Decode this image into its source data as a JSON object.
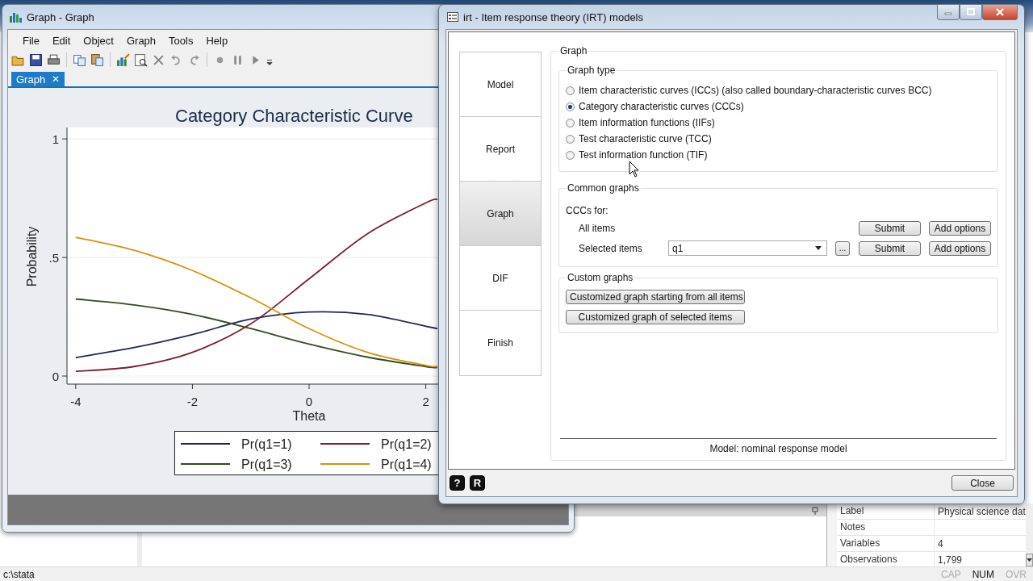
{
  "graph_window": {
    "title": "Graph - Graph",
    "menu": [
      "File",
      "Edit",
      "Object",
      "Graph",
      "Tools",
      "Help"
    ],
    "tabs": [
      {
        "label": "Graph",
        "close": "✕",
        "selected": true
      }
    ],
    "chart_data": {
      "type": "line",
      "title": "Category Characteristic Curve",
      "xlabel": "Theta",
      "ylabel": "Probability",
      "x": [
        -4,
        -3,
        -2,
        -1,
        0,
        1,
        2,
        2.2
      ],
      "series": [
        {
          "name": "Pr(q1=1)",
          "color": "#1b2a52",
          "values": [
            0.078,
            0.12,
            0.175,
            0.24,
            0.27,
            0.26,
            0.21,
            0.2
          ]
        },
        {
          "name": "Pr(q1=2)",
          "color": "#7b1e2d",
          "values": [
            0.02,
            0.04,
            0.1,
            0.22,
            0.41,
            0.6,
            0.73,
            0.745
          ]
        },
        {
          "name": "Pr(q1=3)",
          "color": "#2e4d1e",
          "values": [
            0.325,
            0.3,
            0.26,
            0.2,
            0.135,
            0.08,
            0.04,
            0.035
          ]
        },
        {
          "name": "Pr(q1=4)",
          "color": "#d4920c",
          "values": [
            0.585,
            0.53,
            0.445,
            0.33,
            0.2,
            0.1,
            0.045,
            0.04
          ]
        }
      ],
      "grid": true,
      "legend": true,
      "xlim": [
        -4.15,
        4.15
      ],
      "ylim": [
        -0.034,
        1.048
      ],
      "xticks": [
        -4,
        -2,
        0,
        2
      ],
      "yticks": [
        0,
        {
          "value": 0.5,
          "label": ".5"
        },
        1
      ]
    }
  },
  "dialog": {
    "title": "irt - Item response theory (IRT) models",
    "nav": [
      {
        "label": "Model",
        "selected": false
      },
      {
        "label": "Report",
        "selected": false
      },
      {
        "label": "Graph",
        "selected": true
      },
      {
        "label": "DIF",
        "selected": false
      },
      {
        "label": "Finish",
        "selected": false
      }
    ],
    "group_title": "Graph",
    "graph_type": {
      "title": "Graph type",
      "options": [
        {
          "label": "Item characteristic curves (ICCs) (also called boundary-characteristic curves BCC)",
          "selected": false
        },
        {
          "label": "Category characteristic curves (CCCs)",
          "selected": true
        },
        {
          "label": "Item information functions (IIFs)",
          "selected": false
        },
        {
          "label": "Test characteristic curve (TCC)",
          "selected": false
        },
        {
          "label": "Test information function (TIF)",
          "selected": false
        }
      ]
    },
    "common_graphs": {
      "title": "Common graphs",
      "subtitle": "CCCs for:",
      "rows": [
        {
          "label": "All items",
          "buttons": [
            "Submit",
            "Add options"
          ]
        },
        {
          "label": "Selected items",
          "value": "q1",
          "browse": "...",
          "buttons": [
            "Submit",
            "Add options"
          ]
        }
      ]
    },
    "custom_graphs": {
      "title": "Custom graphs",
      "buttons": [
        "Customized graph starting from all items",
        "Customized graph of selected items"
      ]
    },
    "model_note": "Model: nominal response model",
    "help_buttons": [
      "?",
      "R"
    ],
    "close": "Close"
  },
  "properties": [
    {
      "name": "Label",
      "value": "Physical science dat"
    },
    {
      "name": "Notes"
    },
    {
      "name": "Variables",
      "value": "4"
    },
    {
      "name": "Observations",
      "value": "1,799"
    }
  ],
  "status_bar": {
    "path": "c:\\stata",
    "indicators": [
      {
        "label": "CAP",
        "on": false
      },
      {
        "label": "NUM",
        "on": true
      },
      {
        "label": "OVR",
        "on": false
      }
    ]
  }
}
